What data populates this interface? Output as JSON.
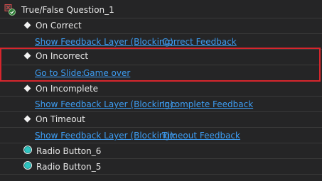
{
  "trigger": {
    "title": "True/False Question_1",
    "icon": "question-slide-icon"
  },
  "events": [
    {
      "name": "On Correct",
      "action": "Show Feedback Layer (Blocking):",
      "target": "Correct Feedback"
    },
    {
      "name": "On Incorrect",
      "action": "Go to Slide:",
      "target": "Game over"
    },
    {
      "name": "On Incomplete",
      "action": "Show Feedback Layer (Blocking):",
      "target": "Incomplete Feedback"
    },
    {
      "name": "On Timeout",
      "action": "Show Feedback Layer (Blocking):",
      "target": "Timeout Feedback"
    }
  ],
  "radio_buttons": [
    {
      "label": "Radio Button_6",
      "icon": "radio-button-icon"
    },
    {
      "label": "Radio Button_5",
      "icon": "radio-button-icon"
    }
  ],
  "colors": {
    "background": "#252526",
    "link": "#3d9df3",
    "highlight": "#d7262d",
    "radio": "#2ec4c0"
  }
}
